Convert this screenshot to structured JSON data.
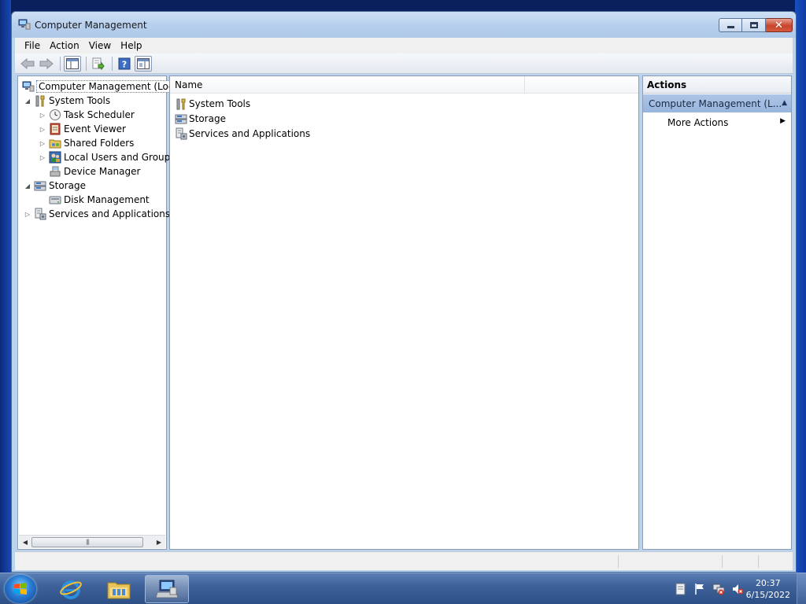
{
  "window": {
    "title": "Computer Management"
  },
  "menu": [
    {
      "label": "File"
    },
    {
      "label": "Action"
    },
    {
      "label": "View"
    },
    {
      "label": "Help"
    }
  ],
  "tree": {
    "root": "Computer Management (Local",
    "items": [
      {
        "label": "System Tools",
        "level": 1,
        "expander": "expanded",
        "icon": "tools-icon"
      },
      {
        "label": "Task Scheduler",
        "level": 2,
        "expander": "collapsed",
        "icon": "clock-icon"
      },
      {
        "label": "Event Viewer",
        "level": 2,
        "expander": "collapsed",
        "icon": "event-viewer-icon"
      },
      {
        "label": "Shared Folders",
        "level": 2,
        "expander": "collapsed",
        "icon": "shared-folder-icon"
      },
      {
        "label": "Local Users and Groups",
        "level": 2,
        "expander": "collapsed",
        "icon": "users-icon"
      },
      {
        "label": "Device Manager",
        "level": 2,
        "expander": "none",
        "icon": "device-manager-icon"
      },
      {
        "label": "Storage",
        "level": 1,
        "expander": "expanded",
        "icon": "storage-icon"
      },
      {
        "label": "Disk Management",
        "level": 2,
        "expander": "none",
        "icon": "disk-icon"
      },
      {
        "label": "Services and Applications",
        "level": 1,
        "expander": "collapsed",
        "icon": "services-icon"
      }
    ]
  },
  "list": {
    "column_name": "Name",
    "rows": [
      {
        "label": "System Tools",
        "icon": "tools-icon"
      },
      {
        "label": "Storage",
        "icon": "storage-icon"
      },
      {
        "label": "Services and Applications",
        "icon": "services-icon"
      }
    ]
  },
  "actions": {
    "header": "Actions",
    "group": "Computer Management (L...",
    "item": "More Actions"
  },
  "taskbar": {
    "time": "20:37",
    "date": "6/15/2022"
  },
  "colors": {
    "selection_outline": "#5c7fb8",
    "actions_group_bg": "#aec5e6",
    "close_button": "#c7442b"
  }
}
